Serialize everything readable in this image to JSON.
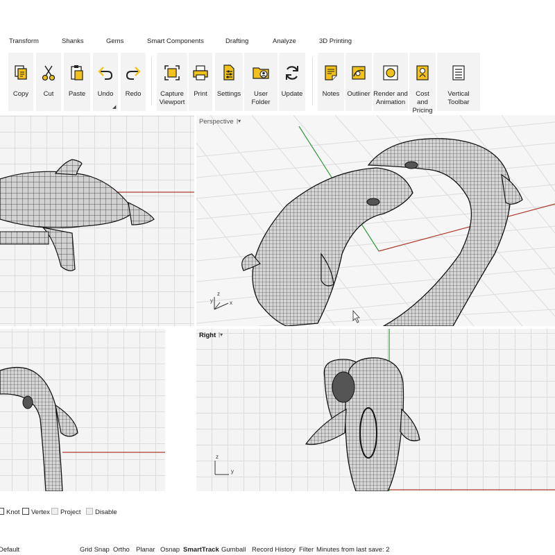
{
  "menu_tabs": [
    "Transform",
    "Shanks",
    "Gems",
    "Smart Components",
    "Drafting",
    "Analyze",
    "3D Printing"
  ],
  "toolbar": {
    "copy": "Copy",
    "cut": "Cut",
    "paste": "Paste",
    "undo": "Undo",
    "redo": "Redo",
    "capture_1": "Capture",
    "capture_2": "Viewport",
    "print": "Print",
    "settings": "Settings",
    "user_folder": "User Folder",
    "update": "Update",
    "notes": "Notes",
    "outliner": "Outliner",
    "render_1": "Render and",
    "render_2": "Animation",
    "cost_1": "Cost and",
    "cost_2": "Pricing",
    "vertical_toolbar": "Vertical Toolbar"
  },
  "viewports": {
    "perspective": {
      "title": "Perspective",
      "axis_z": "z",
      "axis_y": "y",
      "axis_x": "x"
    },
    "right": {
      "title": "Right",
      "axis_z": "z",
      "axis_y": "y"
    }
  },
  "osnap": {
    "knot": "Knot",
    "vertex": "Vertex",
    "project": "Project",
    "disable": "Disable"
  },
  "status": {
    "layer": "Default",
    "grid_snap": "Grid Snap",
    "ortho": "Ortho",
    "planar": "Planar",
    "osnap": "Osnap",
    "smarttrack": "SmartTrack",
    "gumball": "Gumball",
    "record_history": "Record History",
    "filter": "Filter",
    "minutes": "Minutes from last save: 2"
  },
  "colors": {
    "accent": "#f2c21b",
    "x_axis": "#b03a2e",
    "y_axis": "#2e9a3a",
    "grid": "#dcdcdc"
  },
  "icons": [
    "copy-icon",
    "cut-icon",
    "paste-icon",
    "undo-icon",
    "redo-icon",
    "capture-icon",
    "print-icon",
    "settings-icon",
    "folder-icon",
    "update-icon",
    "notes-icon",
    "outliner-icon",
    "render-icon",
    "cost-icon",
    "vertical-toolbar-icon",
    "mouse-cursor-icon"
  ]
}
